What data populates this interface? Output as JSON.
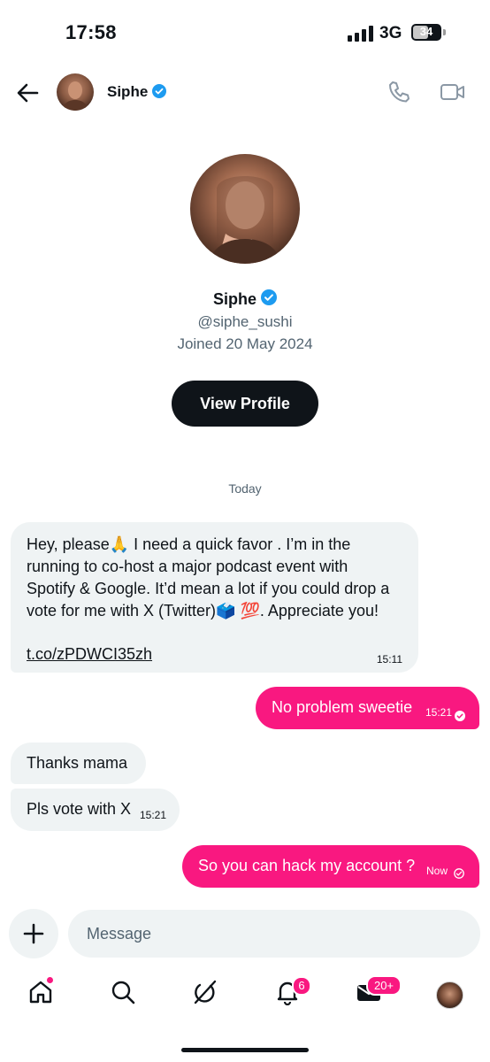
{
  "status_bar": {
    "time": "17:58",
    "network": "3G",
    "battery": "34"
  },
  "header": {
    "name": "Siphe",
    "verified_icon": "verified-badge-icon",
    "icons": [
      "back-arrow-icon",
      "phone-icon",
      "video-camera-icon"
    ]
  },
  "profile": {
    "name": "Siphe",
    "handle": "@siphe_sushi",
    "joined": "Joined 20 May 2024",
    "view_profile_label": "View Profile"
  },
  "conversation": {
    "date_separator": "Today",
    "messages": [
      {
        "direction": "incoming",
        "lines": [
          "Hey, please🙏 I need a quick favor . I’m in the",
          "running to co-host a major podcast event with",
          "Spotify & Google. It’d mean a lot if you could drop a",
          "vote for me with X (Twitter)🗳️ 💯. Appreciate you!"
        ],
        "link": "t.co/zPDWCI35zh",
        "time": "15:11"
      },
      {
        "direction": "outgoing",
        "text": "No problem sweetie",
        "time": "15:21",
        "status_icon": "read-check-icon"
      },
      {
        "direction": "incoming",
        "text": "Thanks mama"
      },
      {
        "direction": "incoming",
        "text": "Pls vote with X",
        "time": "15:21"
      },
      {
        "direction": "outgoing",
        "text": "So you can hack my account ?",
        "time": "Now",
        "status_icon": "sent-check-icon"
      }
    ]
  },
  "composer": {
    "placeholder": "Message",
    "add_icon": "plus-icon"
  },
  "bottom_nav": {
    "items": [
      "home-icon",
      "search-icon",
      "grok-icon",
      "notifications-icon",
      "messages-icon",
      "profile-avatar"
    ],
    "notifications_badge": "6",
    "messages_badge": "20+"
  },
  "colors": {
    "accent": "#f91880",
    "verified": "#1d9bf0",
    "button_dark": "#0f1419",
    "bubble_incoming": "#eff3f4"
  }
}
